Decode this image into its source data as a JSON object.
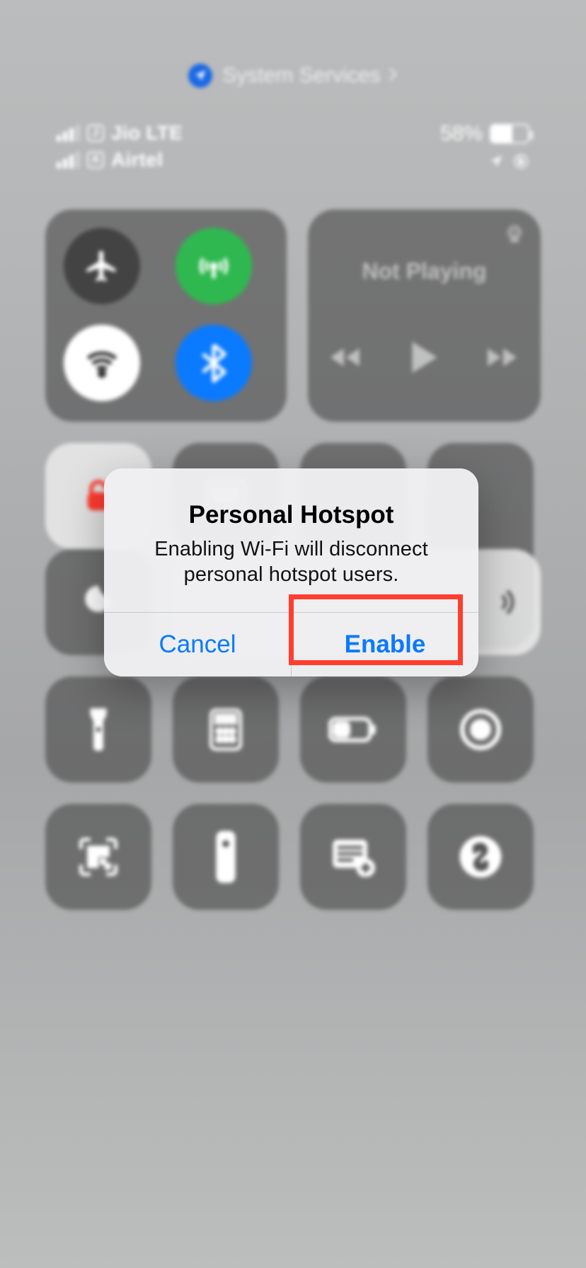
{
  "topbar": {
    "label": "System Services"
  },
  "status": {
    "carrier1": {
      "sim_letter": "J",
      "name": "Jio LTE"
    },
    "carrier2": {
      "sim_letter": "A",
      "name": "Airtel"
    },
    "battery_pct": "58%"
  },
  "media": {
    "label": "Not Playing"
  },
  "alert": {
    "title": "Personal Hotspot",
    "message": "Enabling Wi-Fi will disconnect personal hotspot users.",
    "cancel": "Cancel",
    "enable": "Enable"
  }
}
